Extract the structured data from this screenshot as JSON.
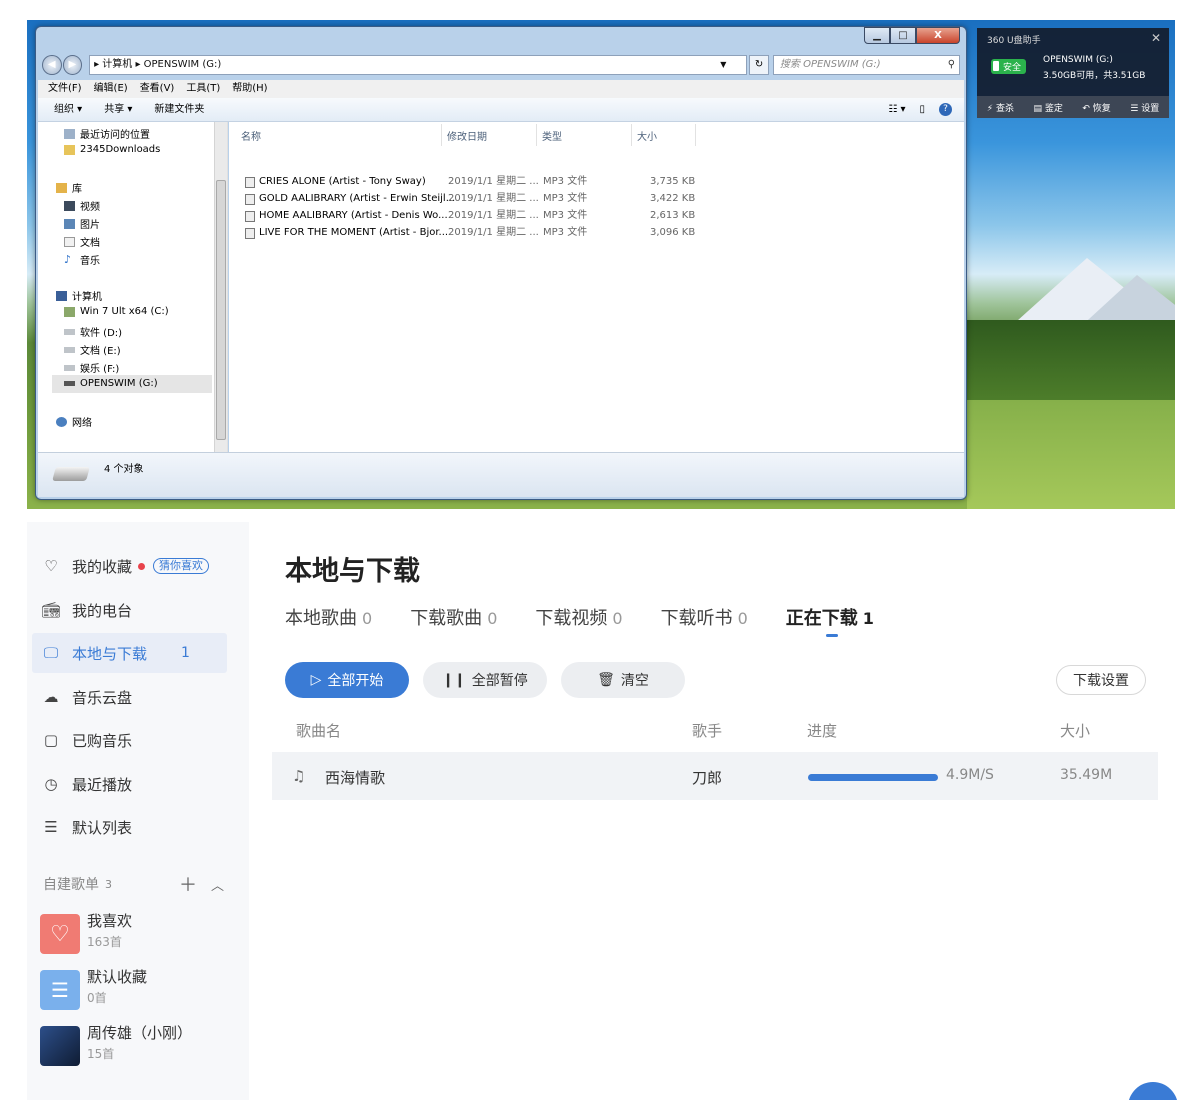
{
  "explorer": {
    "caption_buttons": {
      "min": "▁",
      "max": "□",
      "close": "X"
    },
    "address": {
      "path": "▸ 计算机 ▸ OPENSWIM (G:)",
      "search_placeholder": "搜索 OPENSWIM (G:)"
    },
    "menu": [
      "文件(F)",
      "编辑(E)",
      "查看(V)",
      "工具(T)",
      "帮助(H)"
    ],
    "toolbar": [
      "组织 ▾",
      "共享 ▾",
      "新建文件夹"
    ],
    "nav": {
      "recent": "最近访问的位置",
      "downloads": "2345Downloads",
      "library": "库",
      "lib_items": [
        "视频",
        "图片",
        "文档",
        "音乐"
      ],
      "computer": "计算机",
      "drives": [
        "Win 7 Ult x64 (C:)",
        "软件 (D:)",
        "文档 (E:)",
        "娱乐 (F:)",
        "OPENSWIM (G:)"
      ],
      "network": "网络"
    },
    "columns": [
      "名称",
      "修改日期",
      "类型",
      "大小"
    ],
    "files": [
      {
        "name": "CRIES ALONE (Artist - Tony Sway)",
        "date": "2019/1/1 星期二 ...",
        "type": "MP3 文件",
        "size": "3,735 KB"
      },
      {
        "name": "GOLD AALIBRARY (Artist - Erwin Steijl...",
        "date": "2019/1/1 星期二 ...",
        "type": "MP3 文件",
        "size": "3,422 KB"
      },
      {
        "name": "HOME AALIBRARY (Artist - Denis Wo...",
        "date": "2019/1/1 星期二 ...",
        "type": "MP3 文件",
        "size": "2,613 KB"
      },
      {
        "name": "LIVE FOR THE MOMENT (Artist - Bjor...",
        "date": "2019/1/1 星期二 ...",
        "type": "MP3 文件",
        "size": "3,096 KB"
      }
    ],
    "status": "4 个对象"
  },
  "w360": {
    "title": "360 U盘助手",
    "safe": "安全",
    "drive": "OPENSWIM (G:)",
    "space": "3.50GB可用，共3.51GB",
    "actions": [
      "查杀",
      "鉴定",
      "恢复",
      "设置"
    ]
  },
  "sidebar": {
    "items": [
      {
        "label": "我的收藏",
        "tag": "猜你喜欢"
      },
      {
        "label": "我的电台"
      },
      {
        "label": "本地与下载",
        "count": "1"
      },
      {
        "label": "音乐云盘"
      },
      {
        "label": "已购音乐"
      },
      {
        "label": "最近播放"
      },
      {
        "label": "默认列表"
      }
    ],
    "playlists_title": "自建歌单",
    "playlists_count": "3",
    "playlists": [
      {
        "name": "我喜欢",
        "count": "163首"
      },
      {
        "name": "默认收藏",
        "count": "0首"
      },
      {
        "name": "周传雄（小刚）",
        "count": "15首"
      }
    ]
  },
  "main": {
    "title": "本地与下载",
    "tabs": [
      {
        "label": "本地歌曲",
        "count": "0"
      },
      {
        "label": "下载歌曲",
        "count": "0"
      },
      {
        "label": "下载视频",
        "count": "0"
      },
      {
        "label": "下载听书",
        "count": "0"
      },
      {
        "label": "正在下载",
        "count": "1"
      }
    ],
    "buttons": {
      "start_all": "全部开始",
      "pause_all": "全部暂停",
      "clear": "清空",
      "settings": "下载设置"
    },
    "headers": [
      "歌曲名",
      "歌手",
      "进度",
      "大小"
    ],
    "row": {
      "song": "西海情歌",
      "artist": "刀郎",
      "speed": "4.9M/S",
      "size": "35.49M",
      "progress": 1.0
    },
    "accent": "#3a7bd5"
  }
}
